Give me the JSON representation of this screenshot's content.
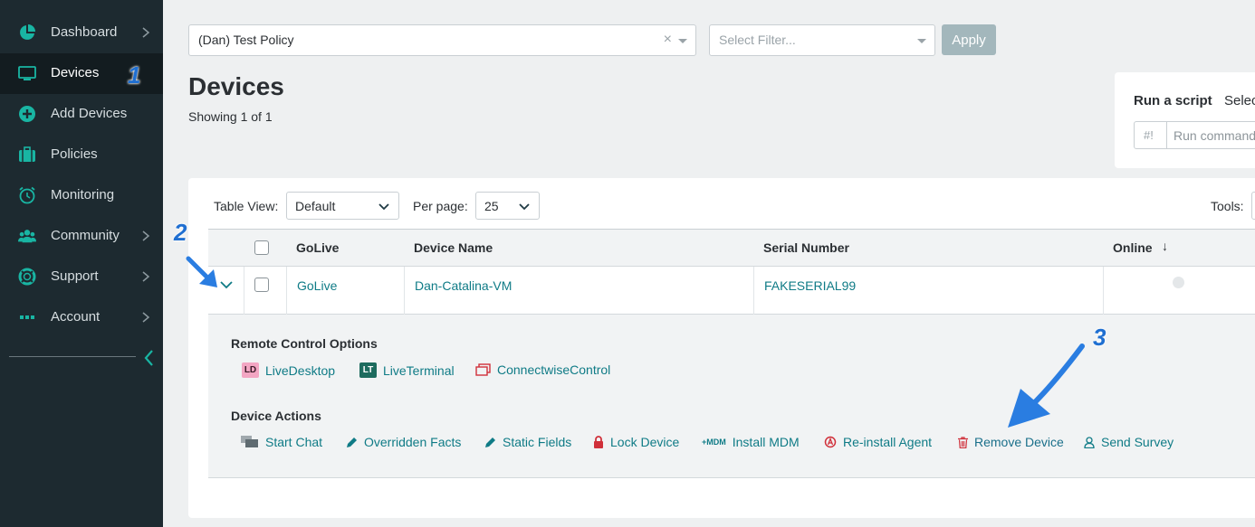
{
  "sidebar": {
    "items": [
      {
        "label": "Dashboard",
        "icon": "pie-chart-icon",
        "has_chevron": true
      },
      {
        "label": "Devices",
        "icon": "monitor-icon",
        "has_chevron": false,
        "active": true
      },
      {
        "label": "Add Devices",
        "icon": "plus-circle-icon",
        "has_chevron": false
      },
      {
        "label": "Policies",
        "icon": "briefcase-icon",
        "has_chevron": false
      },
      {
        "label": "Monitoring",
        "icon": "alarm-clock-icon",
        "has_chevron": false
      },
      {
        "label": "Community",
        "icon": "users-icon",
        "has_chevron": true
      },
      {
        "label": "Support",
        "icon": "lifebuoy-icon",
        "has_chevron": true
      },
      {
        "label": "Account",
        "icon": "dots-icon",
        "has_chevron": true
      }
    ]
  },
  "filters": {
    "policy_value": "(Dan) Test Policy",
    "clear_glyph": "×",
    "filter_placeholder": "Select Filter...",
    "apply_label": "Apply"
  },
  "page": {
    "title": "Devices",
    "showing": "Showing 1 of 1"
  },
  "script_panel": {
    "title": "Run a script",
    "select_label": "Select",
    "prefix": "#!",
    "placeholder": "Run command"
  },
  "toolbar": {
    "table_view_label": "Table View:",
    "table_view_value": "Default",
    "per_page_label": "Per page:",
    "per_page_value": "25",
    "tools_label": "Tools:"
  },
  "table": {
    "headers": {
      "golive": "GoLive",
      "device_name": "Device Name",
      "serial": "Serial Number",
      "online": "Online",
      "sort_glyph": "↓"
    },
    "rows": [
      {
        "golive": "GoLive",
        "device_name": "Dan-Catalina-VM",
        "serial": "FAKESERIAL99"
      }
    ]
  },
  "expanded": {
    "remote_title": "Remote Control Options",
    "remote": [
      {
        "label": "LiveDesktop",
        "icon": "livedesktop-icon",
        "badge": "LD"
      },
      {
        "label": "LiveTerminal",
        "icon": "liveterminal-icon",
        "badge": "LT"
      },
      {
        "label": "ConnectwiseControl",
        "icon": "connectwise-icon"
      }
    ],
    "actions_title": "Device Actions",
    "actions": [
      {
        "label": "Start Chat",
        "icon": "chat-icon"
      },
      {
        "label": "Overridden Facts",
        "icon": "pencil-icon"
      },
      {
        "label": "Static Fields",
        "icon": "pencil-icon"
      },
      {
        "label": "Lock Device",
        "icon": "lock-icon"
      },
      {
        "label": "Install MDM",
        "icon": "mdm-icon",
        "badge": "+MDM"
      },
      {
        "label": "Re-install Agent",
        "icon": "reinstall-icon"
      },
      {
        "label": "Remove Device",
        "icon": "trash-icon"
      },
      {
        "label": "Send Survey",
        "icon": "user-icon"
      }
    ]
  },
  "annotations": {
    "one": "1",
    "two": "2",
    "three": "3"
  },
  "colors": {
    "sidebar_bg": "#1d2a30",
    "accent": "#0f7b86",
    "icon_teal": "#19b5a3",
    "annotation_blue": "#1f6fd1",
    "danger": "#d0303a"
  }
}
